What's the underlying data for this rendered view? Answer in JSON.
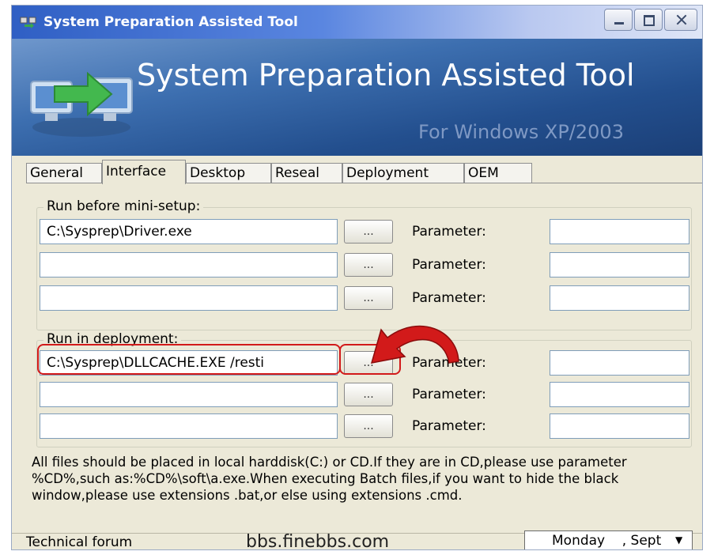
{
  "window": {
    "title": "System Preparation Assisted Tool",
    "controls": {
      "minimize": "minimize",
      "maximize": "maximize",
      "close": "close"
    }
  },
  "banner": {
    "title": "System Preparation Assisted Tool",
    "subtitle": "For Windows XP/2003"
  },
  "tabs": [
    {
      "label": "General",
      "active": false
    },
    {
      "label": "Interface",
      "active": true
    },
    {
      "label": "Desktop",
      "active": false
    },
    {
      "label": "Reseal",
      "active": false
    },
    {
      "label": "Deployment",
      "active": false
    },
    {
      "label": "OEM",
      "active": false
    }
  ],
  "run_before": {
    "label": "Run before mini-setup:",
    "rows": [
      {
        "path": "C:\\Sysprep\\Driver.exe",
        "browse": "...",
        "parameter_label": "Parameter:",
        "parameter_value": ""
      },
      {
        "path": "",
        "browse": "...",
        "parameter_label": "Parameter:",
        "parameter_value": ""
      },
      {
        "path": "",
        "browse": "...",
        "parameter_label": "Parameter:",
        "parameter_value": ""
      }
    ]
  },
  "run_deployment": {
    "label": "Run in deployment:",
    "rows": [
      {
        "path": "C:\\Sysprep\\DLLCACHE.EXE /resti",
        "browse": "...",
        "parameter_label": "Parameter:",
        "parameter_value": ""
      },
      {
        "path": "",
        "browse": "...",
        "parameter_label": "Parameter:",
        "parameter_value": ""
      },
      {
        "path": "",
        "browse": "...",
        "parameter_label": "Parameter:",
        "parameter_value": ""
      }
    ]
  },
  "note": "All files should be placed in local harddisk(C:) or CD.If they are in CD,please use parameter %CD%,such as:%CD%\\soft\\a.exe.When executing Batch files,if you want to hide the black window,please use extensions .bat,or else using  extensions .cmd.",
  "status": {
    "forum_label": "Technical forum",
    "forum_url": "bbs.finebbs.com",
    "date_value": "Monday    , Sept"
  },
  "colors": {
    "annotation": "#d21a1a",
    "banner_top": "#6f97cc",
    "banner_bottom": "#1b3f77",
    "titlebar_start": "#2f5fc4"
  },
  "icons": {
    "app": "sysprep-app-icon",
    "banner": "computers-arrow-icon",
    "annotation": "curved-arrow-icon",
    "dropdown": "chevron-down-icon"
  }
}
